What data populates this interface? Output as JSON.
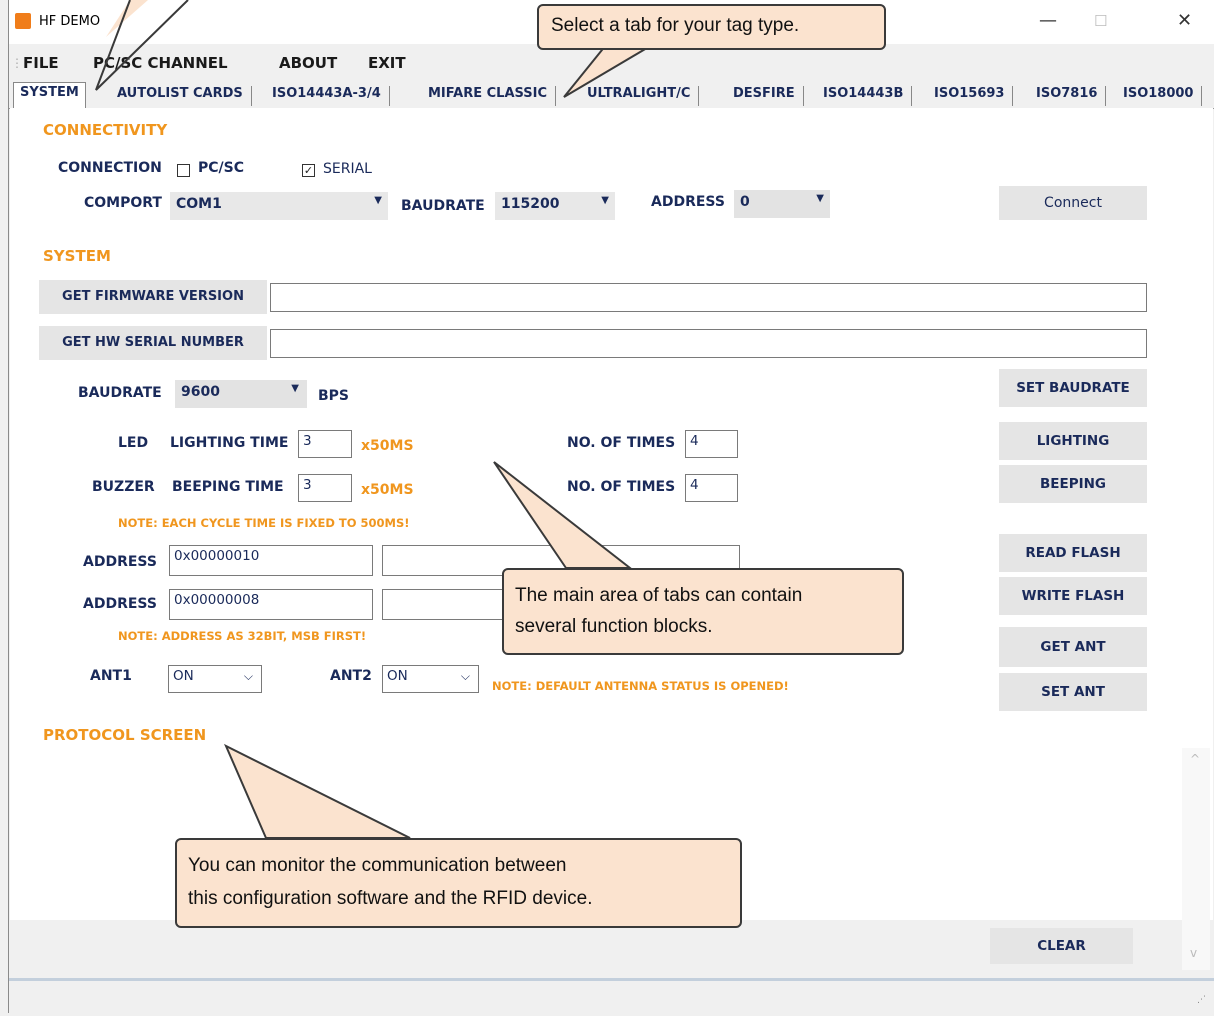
{
  "window": {
    "title": "HF DEMO",
    "minimize": "—",
    "maximize": "☐",
    "close": "✕"
  },
  "menu": [
    "FILE",
    "PC/SC CHANNEL",
    "ABOUT",
    "EXIT"
  ],
  "tabs": [
    "SYSTEM",
    "AUTOLIST CARDS",
    "ISO14443A-3/4",
    "MIFARE CLASSIC",
    "ULTRALIGHT/C",
    "DESFIRE",
    "ISO14443B",
    "ISO15693",
    "ISO7816",
    "ISO18000"
  ],
  "connectivity": {
    "heading": "CONNECTIVITY",
    "connection_label": "CONNECTION",
    "pcsc_label": "PC/SC",
    "pcsc_checked": false,
    "serial_label": "SERIAL",
    "serial_checked": true,
    "comport_label": "COMPORT",
    "comport_value": "COM1",
    "baudrate_label": "BAUDRATE",
    "baudrate_value": "115200",
    "address_label": "ADDRESS",
    "address_value": "0",
    "connect_button": "Connect"
  },
  "system": {
    "heading": "SYSTEM",
    "get_firmware_button": "GET FIRMWARE VERSION",
    "firmware_value": "",
    "get_serial_button": "GET HW SERIAL NUMBER",
    "serial_value": "",
    "baudrate_label": "BAUDRATE",
    "baudrate_value": "9600",
    "bps_label": "BPS",
    "set_baudrate_button": "SET BAUDRATE",
    "led_label": "LED",
    "lighting_time_label": "LIGHTING TIME",
    "lighting_time_value": "3",
    "lighting_unit": "x50MS",
    "led_times_label": "NO. OF TIMES",
    "led_times_value": "4",
    "lighting_button": "LIGHTING",
    "buzzer_label": "BUZZER",
    "beeping_time_label": "BEEPING TIME",
    "beeping_time_value": "3",
    "beeping_unit": "x50MS",
    "buzzer_times_label": "NO. OF TIMES",
    "buzzer_times_value": "4",
    "beeping_button": "BEEPING",
    "cycle_note": "NOTE:  EACH CYCLE TIME IS FIXED TO 500MS!",
    "read_address_label": "ADDRESS",
    "read_address_value": "0x00000010",
    "read_data_value": "",
    "read_flash_button": "READ FLASH",
    "write_address_label": "ADDRESS",
    "write_address_value": "0x00000008",
    "write_data_value": "",
    "write_flash_button": "WRITE FLASH",
    "address_note": "NOTE: ADDRESS AS 32BIT, MSB FIRST!",
    "get_ant_button": "GET ANT",
    "ant1_label": "ANT1",
    "ant1_value": "ON",
    "ant2_label": "ANT2",
    "ant2_value": "ON",
    "antenna_note": "NOTE: DEFAULT ANTENNA STATUS IS OPENED!",
    "set_ant_button": "SET ANT"
  },
  "protocol": {
    "heading": "PROTOCOL SCREEN",
    "clear_button": "CLEAR"
  },
  "callouts": {
    "tabs": "Select a tab for your tag type.",
    "main_line1": "The main area of tabs can contain",
    "main_line2": "several function blocks.",
    "protocol_line1": "You can monitor the communication between",
    "protocol_line2": "this configuration software and the RFID device."
  },
  "colors": {
    "accent": "#f0961e",
    "label": "#1a2a5a",
    "callout_fill": "#fbe3cf",
    "app_icon": "#f07d1a"
  }
}
